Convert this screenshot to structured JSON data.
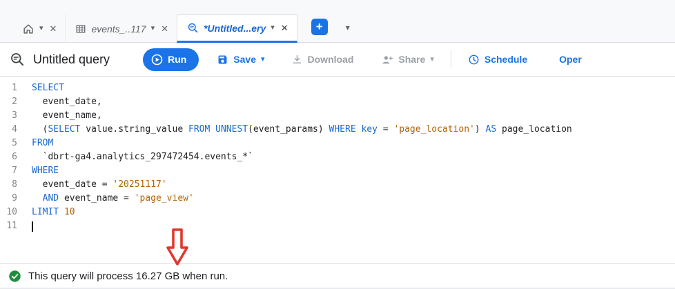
{
  "icons": {
    "caret": "▾",
    "close": "✕",
    "plus": "+"
  },
  "tabbar": {
    "tabs": [
      {
        "label": "events_..117"
      },
      {
        "label": "*Untitled...ery"
      }
    ]
  },
  "toolbar": {
    "title": "Untitled query",
    "run_label": "Run",
    "save_label": "Save",
    "download_label": "Download",
    "share_label": "Share",
    "schedule_label": "Schedule",
    "open_label": "Oper"
  },
  "editor": {
    "lines": [
      {
        "n": "1",
        "segs": [
          [
            "SELECT",
            "kw"
          ]
        ]
      },
      {
        "n": "2",
        "segs": [
          [
            "  event_date,",
            "pl"
          ]
        ]
      },
      {
        "n": "3",
        "segs": [
          [
            "  event_name,",
            "pl"
          ]
        ]
      },
      {
        "n": "4",
        "segs": [
          [
            "  (",
            "pl"
          ],
          [
            "SELECT",
            "kw"
          ],
          [
            " value.string_value ",
            "pl"
          ],
          [
            "FROM",
            "kw"
          ],
          [
            " ",
            "pl"
          ],
          [
            "UNNEST",
            "kw"
          ],
          [
            "(event_params) ",
            "pl"
          ],
          [
            "WHERE",
            "kw"
          ],
          [
            " ",
            "pl"
          ],
          [
            "key",
            "kw"
          ],
          [
            " = ",
            "pl"
          ],
          [
            "'page_location'",
            "str"
          ],
          [
            ") ",
            "pl"
          ],
          [
            "AS",
            "kw"
          ],
          [
            " page_location",
            "pl"
          ]
        ]
      },
      {
        "n": "5",
        "segs": [
          [
            "FROM",
            "kw"
          ]
        ]
      },
      {
        "n": "6",
        "segs": [
          [
            "  `dbrt-ga4.analytics_297472454.events_*`",
            "pl"
          ]
        ]
      },
      {
        "n": "7",
        "segs": [
          [
            "WHERE",
            "kw"
          ]
        ]
      },
      {
        "n": "8",
        "segs": [
          [
            "  event_date = ",
            "pl"
          ],
          [
            "'20251117'",
            "str"
          ]
        ]
      },
      {
        "n": "9",
        "segs": [
          [
            "  ",
            "pl"
          ],
          [
            "AND",
            "kw"
          ],
          [
            " event_name = ",
            "pl"
          ],
          [
            "'page_view'",
            "str"
          ]
        ]
      },
      {
        "n": "10",
        "segs": [
          [
            "LIMIT",
            "kw"
          ],
          [
            " ",
            "pl"
          ],
          [
            "10",
            "num"
          ]
        ]
      },
      {
        "n": "11",
        "segs": [],
        "cursor": true
      }
    ]
  },
  "status": {
    "message": "This query will process 16.27 GB when run."
  },
  "colors": {
    "accent": "#1a73e8",
    "kw": "#1967d2",
    "str": "#b26205",
    "num": "#b26205",
    "success": "#1e8e3e",
    "arrow": "#df392c"
  }
}
